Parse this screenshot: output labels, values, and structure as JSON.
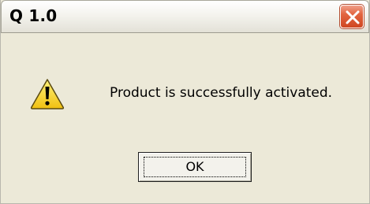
{
  "window": {
    "title": "Q 1.0"
  },
  "titlebar": {
    "close_icon": "close-icon"
  },
  "dialog": {
    "icon": "warning-icon",
    "message": "Product is successfully activated.",
    "ok_label": "OK"
  },
  "colors": {
    "dialog_bg": "#ece9d8",
    "close_button": "#e2643f",
    "warning_yellow": "#f6d21d"
  }
}
